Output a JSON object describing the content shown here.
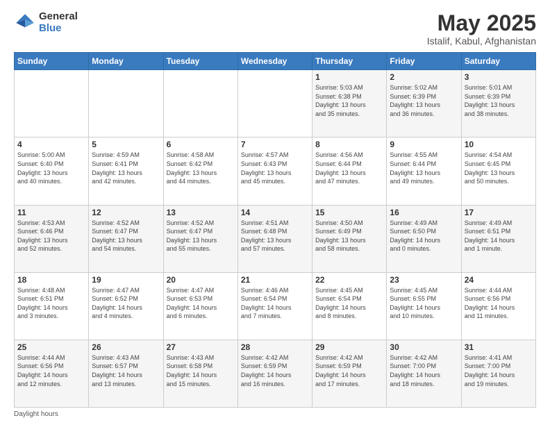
{
  "header": {
    "logo_general": "General",
    "logo_blue": "Blue",
    "month_title": "May 2025",
    "location": "Istalif, Kabul, Afghanistan"
  },
  "weekdays": [
    "Sunday",
    "Monday",
    "Tuesday",
    "Wednesday",
    "Thursday",
    "Friday",
    "Saturday"
  ],
  "footer_label": "Daylight hours",
  "weeks": [
    [
      {
        "day": "",
        "info": ""
      },
      {
        "day": "",
        "info": ""
      },
      {
        "day": "",
        "info": ""
      },
      {
        "day": "",
        "info": ""
      },
      {
        "day": "1",
        "info": "Sunrise: 5:03 AM\nSunset: 6:38 PM\nDaylight: 13 hours\nand 35 minutes."
      },
      {
        "day": "2",
        "info": "Sunrise: 5:02 AM\nSunset: 6:39 PM\nDaylight: 13 hours\nand 36 minutes."
      },
      {
        "day": "3",
        "info": "Sunrise: 5:01 AM\nSunset: 6:39 PM\nDaylight: 13 hours\nand 38 minutes."
      }
    ],
    [
      {
        "day": "4",
        "info": "Sunrise: 5:00 AM\nSunset: 6:40 PM\nDaylight: 13 hours\nand 40 minutes."
      },
      {
        "day": "5",
        "info": "Sunrise: 4:59 AM\nSunset: 6:41 PM\nDaylight: 13 hours\nand 42 minutes."
      },
      {
        "day": "6",
        "info": "Sunrise: 4:58 AM\nSunset: 6:42 PM\nDaylight: 13 hours\nand 44 minutes."
      },
      {
        "day": "7",
        "info": "Sunrise: 4:57 AM\nSunset: 6:43 PM\nDaylight: 13 hours\nand 45 minutes."
      },
      {
        "day": "8",
        "info": "Sunrise: 4:56 AM\nSunset: 6:44 PM\nDaylight: 13 hours\nand 47 minutes."
      },
      {
        "day": "9",
        "info": "Sunrise: 4:55 AM\nSunset: 6:44 PM\nDaylight: 13 hours\nand 49 minutes."
      },
      {
        "day": "10",
        "info": "Sunrise: 4:54 AM\nSunset: 6:45 PM\nDaylight: 13 hours\nand 50 minutes."
      }
    ],
    [
      {
        "day": "11",
        "info": "Sunrise: 4:53 AM\nSunset: 6:46 PM\nDaylight: 13 hours\nand 52 minutes."
      },
      {
        "day": "12",
        "info": "Sunrise: 4:52 AM\nSunset: 6:47 PM\nDaylight: 13 hours\nand 54 minutes."
      },
      {
        "day": "13",
        "info": "Sunrise: 4:52 AM\nSunset: 6:47 PM\nDaylight: 13 hours\nand 55 minutes."
      },
      {
        "day": "14",
        "info": "Sunrise: 4:51 AM\nSunset: 6:48 PM\nDaylight: 13 hours\nand 57 minutes."
      },
      {
        "day": "15",
        "info": "Sunrise: 4:50 AM\nSunset: 6:49 PM\nDaylight: 13 hours\nand 58 minutes."
      },
      {
        "day": "16",
        "info": "Sunrise: 4:49 AM\nSunset: 6:50 PM\nDaylight: 14 hours\nand 0 minutes."
      },
      {
        "day": "17",
        "info": "Sunrise: 4:49 AM\nSunset: 6:51 PM\nDaylight: 14 hours\nand 1 minute."
      }
    ],
    [
      {
        "day": "18",
        "info": "Sunrise: 4:48 AM\nSunset: 6:51 PM\nDaylight: 14 hours\nand 3 minutes."
      },
      {
        "day": "19",
        "info": "Sunrise: 4:47 AM\nSunset: 6:52 PM\nDaylight: 14 hours\nand 4 minutes."
      },
      {
        "day": "20",
        "info": "Sunrise: 4:47 AM\nSunset: 6:53 PM\nDaylight: 14 hours\nand 6 minutes."
      },
      {
        "day": "21",
        "info": "Sunrise: 4:46 AM\nSunset: 6:54 PM\nDaylight: 14 hours\nand 7 minutes."
      },
      {
        "day": "22",
        "info": "Sunrise: 4:45 AM\nSunset: 6:54 PM\nDaylight: 14 hours\nand 8 minutes."
      },
      {
        "day": "23",
        "info": "Sunrise: 4:45 AM\nSunset: 6:55 PM\nDaylight: 14 hours\nand 10 minutes."
      },
      {
        "day": "24",
        "info": "Sunrise: 4:44 AM\nSunset: 6:56 PM\nDaylight: 14 hours\nand 11 minutes."
      }
    ],
    [
      {
        "day": "25",
        "info": "Sunrise: 4:44 AM\nSunset: 6:56 PM\nDaylight: 14 hours\nand 12 minutes."
      },
      {
        "day": "26",
        "info": "Sunrise: 4:43 AM\nSunset: 6:57 PM\nDaylight: 14 hours\nand 13 minutes."
      },
      {
        "day": "27",
        "info": "Sunrise: 4:43 AM\nSunset: 6:58 PM\nDaylight: 14 hours\nand 15 minutes."
      },
      {
        "day": "28",
        "info": "Sunrise: 4:42 AM\nSunset: 6:59 PM\nDaylight: 14 hours\nand 16 minutes."
      },
      {
        "day": "29",
        "info": "Sunrise: 4:42 AM\nSunset: 6:59 PM\nDaylight: 14 hours\nand 17 minutes."
      },
      {
        "day": "30",
        "info": "Sunrise: 4:42 AM\nSunset: 7:00 PM\nDaylight: 14 hours\nand 18 minutes."
      },
      {
        "day": "31",
        "info": "Sunrise: 4:41 AM\nSunset: 7:00 PM\nDaylight: 14 hours\nand 19 minutes."
      }
    ]
  ]
}
